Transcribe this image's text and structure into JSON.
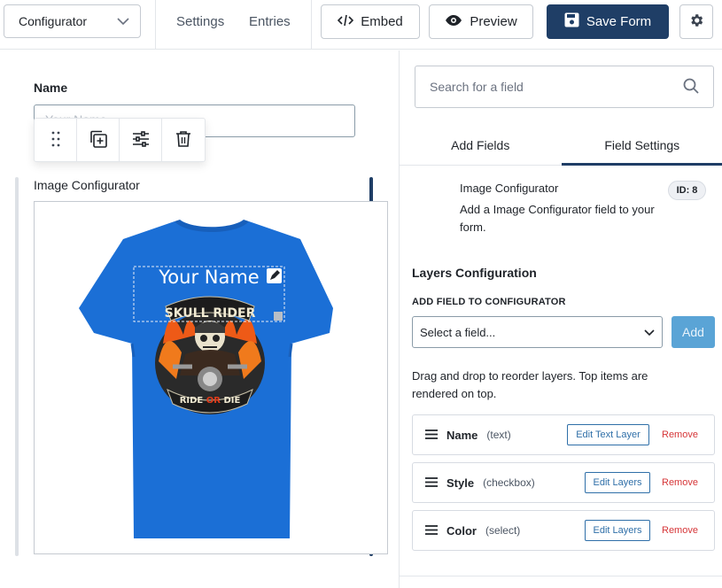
{
  "topbar": {
    "form_select_value": "Configurator",
    "nav": [
      "Settings",
      "Entries"
    ],
    "embed_label": "Embed",
    "preview_label": "Preview",
    "save_label": "Save Form"
  },
  "canvas": {
    "name_field": {
      "label": "Name",
      "placeholder": "Your Name"
    },
    "image_field": {
      "label": "Image Configurator",
      "overlay_text": "Your Name"
    },
    "shirt_color": "#1b6fd6",
    "graphic": {
      "top_text": "SKULL RIDER",
      "bottom_text_1": "RIDE",
      "bottom_text_2": "OR",
      "bottom_text_3": "DIE"
    }
  },
  "panel": {
    "search_placeholder": "Search for a field",
    "tabs": [
      "Add Fields",
      "Field Settings"
    ],
    "active_tab": "Field Settings",
    "field_info": {
      "title": "Image Configurator",
      "description": "Add a Image Configurator field to your form.",
      "id_badge": "ID: 8"
    },
    "layers_section": {
      "title": "Layers Configuration",
      "add_label": "ADD FIELD TO CONFIGURATOR",
      "select_placeholder": "Select a field...",
      "add_button": "Add",
      "help": "Drag and drop to reorder layers. Top items are rendered on top.",
      "layers": [
        {
          "name": "Name",
          "type": "(text)",
          "edit": "Edit Text Layer",
          "remove": "Remove"
        },
        {
          "name": "Style",
          "type": "(checkbox)",
          "edit": "Edit Layers",
          "remove": "Remove"
        },
        {
          "name": "Color",
          "type": "(select)",
          "edit": "Edit Layers",
          "remove": "Remove"
        }
      ]
    }
  },
  "colors": {
    "primary": "#1f3e66",
    "accent_blue": "#2f6fa8",
    "add_button": "#5aa4d6",
    "remove": "#d63638"
  },
  "icons": [
    "chevron-down-icon",
    "code-icon",
    "eye-icon",
    "save-disk-icon",
    "gear-icon",
    "drag-dots-icon",
    "duplicate-icon",
    "sliders-icon",
    "trash-icon",
    "search-icon",
    "pencil-icon",
    "hamburger-icon"
  ]
}
